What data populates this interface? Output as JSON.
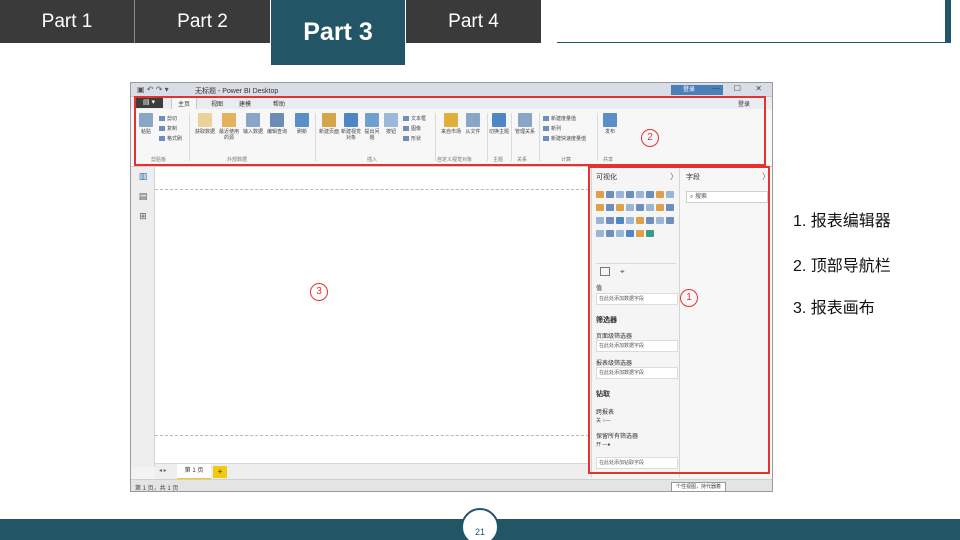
{
  "nav": {
    "tabs": [
      {
        "label": "Part 1",
        "active": false
      },
      {
        "label": "Part 2",
        "active": false
      },
      {
        "label": "Part 3",
        "active": true
      },
      {
        "label": "Part 4",
        "active": false
      }
    ]
  },
  "screenshot": {
    "titlebar": {
      "qa": "▣ ↶ ↷ ▾",
      "title": "无标题 - Power BI Desktop",
      "login_button": "登录",
      "window_buttons": "— ☐ ✕"
    },
    "menubar": {
      "file_label": "▤ ▾",
      "tabs": [
        "主页",
        "视图",
        "建模",
        "帮助"
      ],
      "login": "登录"
    },
    "ribbon": {
      "buttons": [
        {
          "label": "粘贴",
          "color": "#8aa6c6"
        },
        {
          "label": "获取数据",
          "color": "#e9d39b"
        },
        {
          "label": "最近使用的源",
          "color": "#e2b25f"
        },
        {
          "label": "输入数据",
          "color": "#8aa6c6"
        },
        {
          "label": "编辑查询",
          "color": "#6b8cb5"
        },
        {
          "label": "刷新",
          "color": "#5b8fc8"
        },
        {
          "label": "新建页面",
          "color": "#d6a54a"
        },
        {
          "label": "新建视觉对象",
          "color": "#4f86c6"
        },
        {
          "label": "提出问题",
          "color": "#6fa0d0"
        },
        {
          "label": "按钮",
          "color": "#9bbadb"
        },
        {
          "label": "来自市场",
          "color": "#e0b03b"
        },
        {
          "label": "从文件",
          "color": "#8aa6c6"
        },
        {
          "label": "切换主题",
          "color": "#4f86c6"
        },
        {
          "label": "管理关系",
          "color": "#8aa6c6"
        },
        {
          "label": "发布",
          "color": "#5b8fc8"
        }
      ],
      "small_items": {
        "clipboard": [
          "剪切",
          "复制",
          "格式刷"
        ],
        "insert": [
          "文本框",
          "图像",
          "形状"
        ],
        "calc": [
          "新建度量值",
          "新列",
          "新建快速度量值"
        ]
      },
      "groups": [
        "剪贴板",
        "外部数据",
        "插入",
        "自定义视觉对象",
        "主题",
        "关系",
        "计算",
        "共享"
      ]
    },
    "visualizations": {
      "title": "可视化",
      "chevron": "〉",
      "values_label": "值",
      "values_placeholder": "在此处添加数据字段",
      "filters_title": "筛选器",
      "page_filter_label": "页面级筛选器",
      "page_filter_placeholder": "在此处添加数据字段",
      "report_filter_label": "报表级筛选器",
      "report_filter_placeholder": "在此处添加数据字段",
      "drillthrough_title": "钻取",
      "cross_report_label": "跨报表",
      "cross_report_state": "关 ○—",
      "keep_filters_label": "保留所有筛选器",
      "keep_filters_state": "开 —●",
      "drill_placeholder": "在此处添加钻取字段"
    },
    "fields": {
      "title": "字段",
      "chevron": "〉",
      "search_placeholder": "⌕ 搜索"
    },
    "left_rail_icons": [
      "report-icon",
      "data-icon",
      "relationships-icon"
    ],
    "left_rail_glyphs": [
      "▥",
      "▤",
      "⊞"
    ],
    "pages": {
      "nav": "◂ ▸",
      "page_tab": "第 1 页",
      "add_page": "+"
    },
    "status": {
      "page_indicator": "第 1 页，共 1 页",
      "tooltip": "个性视图，持代器着"
    }
  },
  "annotations": [
    {
      "number": "1"
    },
    {
      "number": "2"
    },
    {
      "number": "3"
    }
  ],
  "legend": [
    "1. 报表编辑器",
    "2. 顶部导航栏",
    "3. 报表画布"
  ],
  "footer": {
    "page_number": "21"
  },
  "colors": {
    "accent": "#225566",
    "dark_tab": "#3a3a3a",
    "annotation_red": "#e2332f",
    "page_tab_yellow": "#f2c811"
  }
}
